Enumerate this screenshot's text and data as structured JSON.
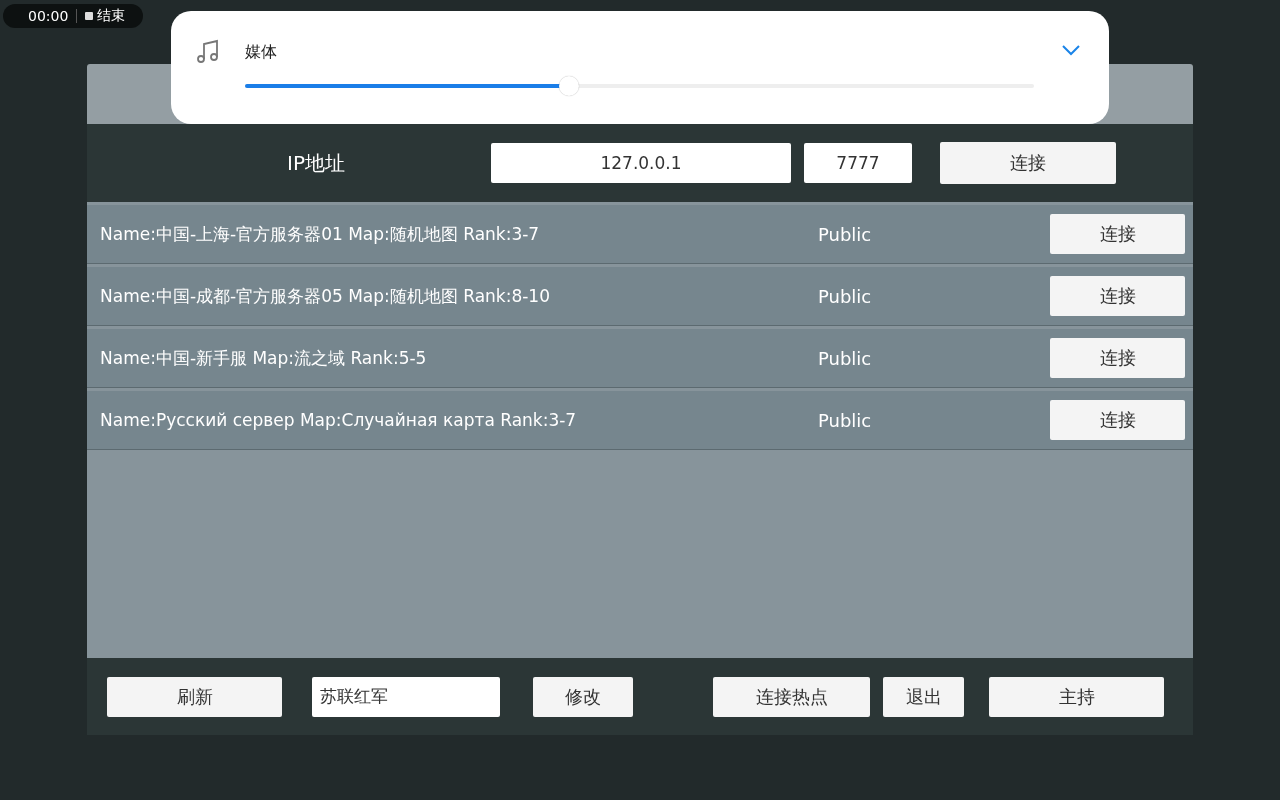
{
  "recorder": {
    "time": "00:00",
    "stop_label": "结束"
  },
  "volume_popup": {
    "label": "媒体",
    "level": 0.4
  },
  "connect_bar": {
    "label": "IP地址",
    "ip": "127.0.0.1",
    "port": "7777",
    "button": "连接"
  },
  "servers": [
    {
      "info": "Name:中国-上海-官方服务器01 Map:随机地图 Rank:3-7",
      "access": "Public",
      "button": "连接"
    },
    {
      "info": "Name:中国-成都-官方服务器05 Map:随机地图 Rank:8-10",
      "access": "Public",
      "button": "连接"
    },
    {
      "info": "Name:中国-新手服 Map:流之域 Rank:5-5",
      "access": "Public",
      "button": "连接"
    },
    {
      "info": "Name:Русский сервер Map:Случайная карта Rank:3-7",
      "access": "Public",
      "button": "连接"
    }
  ],
  "bottom_bar": {
    "refresh": "刷新",
    "player_name": "苏联红军",
    "rename": "修改",
    "hotspot": "连接热点",
    "exit": "退出",
    "host": "主持"
  }
}
